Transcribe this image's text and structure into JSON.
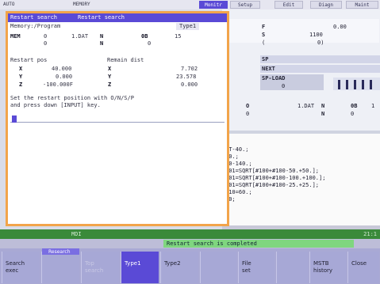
{
  "topbar": {
    "mode": "AUTO",
    "memory": "MEMORY",
    "tabs": [
      "Monitr",
      "Setup",
      "Edit",
      "Diagn",
      "Maint"
    ]
  },
  "dialog": {
    "title_left": "Restart search",
    "title_right": "Restart search",
    "row_memory": "Memory:/Program",
    "row_type": "Type1",
    "mem_label": "MEM",
    "mem_val1": "0",
    "mem_val2": "1.DAT",
    "mem_n": "N",
    "mem_0b": "0B",
    "mem_num": "15",
    "r2_0": "0",
    "r2_n": "N",
    "r2_0b": "0",
    "restart_pos_label": "Restart pos",
    "remain_dist_label": "Remain dist",
    "axes": [
      {
        "axis": "X",
        "pos": "40.000",
        "raxis": "X",
        "rem": "7.702"
      },
      {
        "axis": "Y",
        "pos": "0.000",
        "raxis": "Y",
        "rem": "23.578"
      },
      {
        "axis": "Z",
        "pos": "-100.000F",
        "raxis": "Z",
        "rem": "0.000"
      }
    ],
    "instruction": "Set the restart position with O/N/S/P\nand press down [INPUT] key."
  },
  "monitor": {
    "f_label": "F",
    "f_val": "0.00",
    "s_label": "S",
    "s_val": "1100",
    "paren": "(",
    "paren_val": "0)",
    "sp_label": "SP",
    "next_label": "NEXT",
    "sp_load_label": "SP-LOAD",
    "sp_load_val": "0",
    "o_label": "O",
    "o_val": "1.DAT",
    "o_n": "N",
    "o_0b": "0B",
    "o_num": "1",
    "o2": "0",
    "o2_n": "N",
    "o2_0": "0"
  },
  "program_lines": [
    "ZT-40.;",
    "X0.;",
    "X0-140.;",
    "X01=SQRT[#100+#100-50.+50.];",
    "X01=SQRT[#100+#100-100.+100.];",
    "X01=SQRT[#100+#100-25.+25.];",
    "X10=60.;",
    "X0;"
  ],
  "status": {
    "mode": "MDI",
    "time": "21:1"
  },
  "message": "Restart search is completed",
  "softkeys": [
    {
      "line1": "Search",
      "line2": "exec",
      "state": "normal"
    },
    {
      "line1": "",
      "line2": "",
      "state": "normal",
      "tab": "Research"
    },
    {
      "line1": "Top",
      "line2": "search",
      "state": "dim"
    },
    {
      "line1": "Type1",
      "line2": "",
      "state": "on"
    },
    {
      "line1": "Type2",
      "line2": "",
      "state": "normal"
    },
    {
      "line1": "",
      "line2": "",
      "state": "normal"
    },
    {
      "line1": "File",
      "line2": "set",
      "state": "normal"
    },
    {
      "line1": "",
      "line2": "",
      "state": "normal"
    },
    {
      "line1": "MSTB",
      "line2": "history",
      "state": "normal"
    },
    {
      "line1": "Close",
      "line2": "",
      "state": "normal"
    }
  ]
}
